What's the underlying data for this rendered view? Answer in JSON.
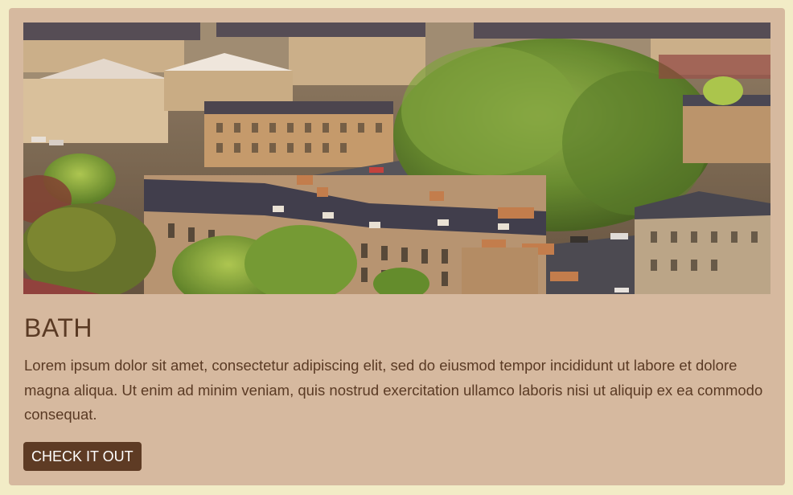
{
  "card": {
    "image_alt": "Aerial view of Bath with Georgian terraces around a large tree",
    "title": "BATH",
    "description": "Lorem ipsum dolor sit amet, consectetur adipiscing elit, sed do eiusmod tempor incididunt ut labore et dolore magna aliqua. Ut enim ad minim veniam, quis nostrud exercitation ullamco laboris nisi ut aliquip ex ea commodo consequat.",
    "button_label": "CHECK IT OUT"
  },
  "colors": {
    "page_background": "#f2ecc6",
    "card_background": "#d6b99f",
    "text": "#5a3a24",
    "button_background": "#5e3b24",
    "button_text": "#ffffff"
  }
}
